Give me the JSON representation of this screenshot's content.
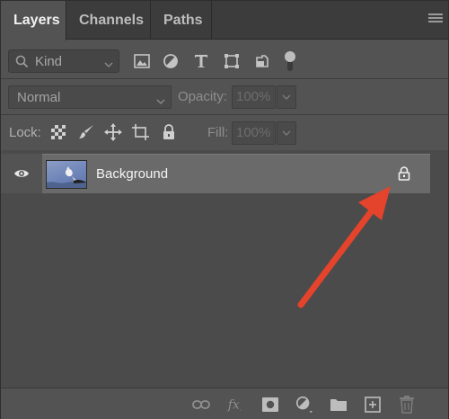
{
  "tabs": [
    {
      "label": "Layers",
      "active": true
    },
    {
      "label": "Channels",
      "active": false
    },
    {
      "label": "Paths",
      "active": false
    }
  ],
  "filter": {
    "kind_label": "Kind",
    "icons": [
      "image-filter-icon",
      "adjustment-filter-icon",
      "type-filter-icon",
      "shape-filter-icon",
      "smart-object-filter-icon",
      "filter-toggle"
    ]
  },
  "blend": {
    "mode": "Normal",
    "opacity_label": "Opacity:",
    "opacity_value": "100%"
  },
  "lock": {
    "label": "Lock:",
    "icons": [
      "lock-transparent-pixels-icon",
      "lock-image-pixels-icon",
      "lock-position-icon",
      "lock-artboard-icon",
      "lock-all-icon"
    ],
    "fill_label": "Fill:",
    "fill_value": "100%"
  },
  "layers": [
    {
      "name": "Background",
      "visible": true,
      "locked": true
    }
  ],
  "bottom_toolbar": [
    "link-layers-icon",
    "fx-icon",
    "add-mask-icon",
    "new-adjustment-icon",
    "new-group-icon",
    "new-layer-icon",
    "delete-layer-icon"
  ],
  "colors": {
    "panel_bg": "#535353",
    "tabbar_bg": "#3c3c3c",
    "selected_layer": "#6a6a6a",
    "annotation_arrow": "#e4432c"
  }
}
